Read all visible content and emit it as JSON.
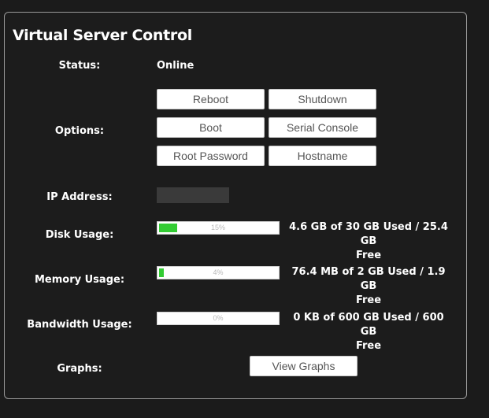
{
  "title": "Virtual Server Control",
  "status": {
    "label": "Status:",
    "value": "Online"
  },
  "options": {
    "label": "Options:",
    "buttons": {
      "reboot": "Reboot",
      "shutdown": "Shutdown",
      "boot": "Boot",
      "serial_console": "Serial Console",
      "root_password": "Root Password",
      "hostname": "Hostname"
    }
  },
  "ip_address": {
    "label": "IP Address:",
    "value": ""
  },
  "disk_usage": {
    "label": "Disk Usage:",
    "percent": 15,
    "percent_text": "15%",
    "line1": "4.6 GB of 30 GB Used / 25.4 GB",
    "line2": "Free"
  },
  "memory_usage": {
    "label": "Memory Usage:",
    "percent": 4,
    "percent_text": "4%",
    "line1": "76.4 MB of 2 GB Used / 1.9 GB",
    "line2": "Free"
  },
  "bandwidth_usage": {
    "label": "Bandwidth Usage:",
    "percent": 0,
    "percent_text": "0%",
    "line1": "0 KB of 600 GB Used / 600 GB",
    "line2": "Free"
  },
  "graphs": {
    "label": "Graphs:",
    "button": "View Graphs"
  },
  "colors": {
    "background": "#1b1b1b",
    "panel_border": "#9a9a9a",
    "bar_fill": "#33cc33"
  }
}
